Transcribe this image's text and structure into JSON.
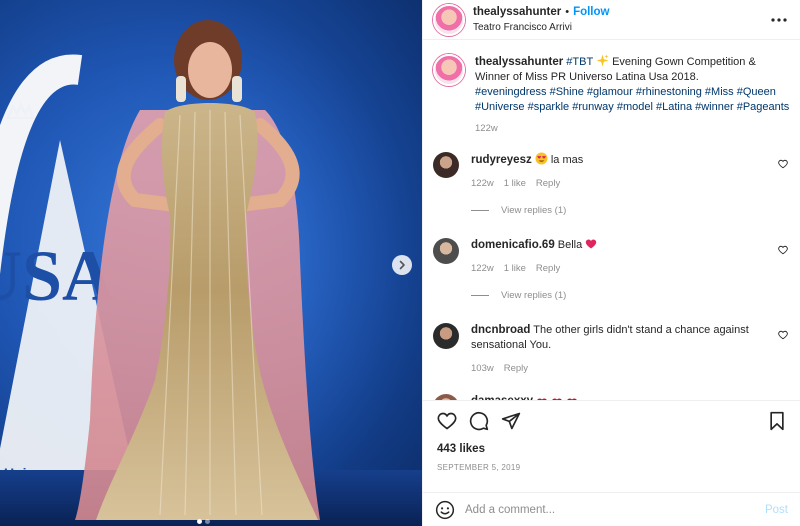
{
  "header": {
    "username": "thealyssahunter",
    "separator": "•",
    "follow_label": "Follow",
    "location": "Teatro Francisco Arrivi"
  },
  "caption": {
    "username": "thealyssahunter",
    "hashtag_tbt": "#TBT",
    "text": " Evening Gown Competition & Winner of Miss PR Universo Latina Usa 2018.",
    "hashtags": "#eveningdress #Shine #glamour #rhinestoning #Miss #Queen #Universe #sparkle #runway #model #Latina #winner #Pageants",
    "time": "122w"
  },
  "comments": [
    {
      "username": "rudyreyesz",
      "text": " la mas",
      "time": "122w",
      "likes": "1 like",
      "reply": "Reply",
      "view_replies": "View replies (1)"
    },
    {
      "username": "domenicafio.69",
      "text": "Bella ",
      "time": "122w",
      "likes": "1 like",
      "reply": "Reply",
      "view_replies": "View replies (1)"
    },
    {
      "username": "dncnbroad",
      "text": "The other girls didn't stand a chance against sensational You.",
      "time": "103w",
      "reply": "Reply"
    },
    {
      "username": "damasexxy",
      "text": ""
    }
  ],
  "actions": {
    "likes": "443 likes",
    "date": "SEPTEMBER 5, 2019"
  },
  "add_comment": {
    "placeholder": "Add a comment...",
    "post_label": "Post"
  },
  "media": {
    "stage_text": "USA",
    "stage_text_small": "Universo",
    "slide_count": 2,
    "active_slide": 1
  },
  "colors": {
    "link": "#0095f6",
    "hashtag": "#00376b",
    "muted": "#8e8e8e",
    "heart_red": "#ed4956",
    "stage_blue": "#1f56b4"
  }
}
